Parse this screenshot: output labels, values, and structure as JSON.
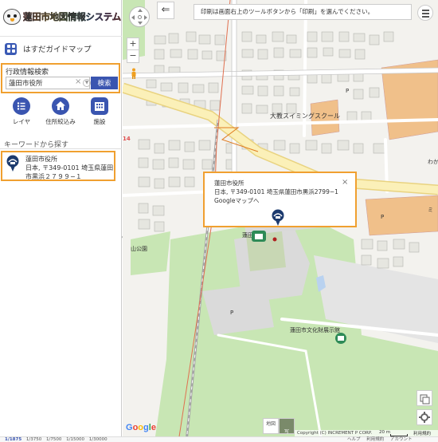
{
  "app": {
    "title": "蓮田市地図情報システム",
    "guide_map": "はすだガイドマップ"
  },
  "search": {
    "label": "行政情報検索",
    "value": "蓮田市役所",
    "clear_glyph": "×",
    "button": "検索"
  },
  "tools": [
    {
      "label": "レイヤ",
      "icon": "list-icon"
    },
    {
      "label": "住所絞込み",
      "icon": "home-icon"
    },
    {
      "label": "施設",
      "icon": "building-icon"
    }
  ],
  "keyword_label": "キーワードから探す",
  "result": {
    "name": "蓮田市役所",
    "address": "日本, 〒349-0101 埼玉県蓮田市黒浜２７９９−１"
  },
  "collapse_glyph": "«",
  "map": {
    "notice": "印刷は画面右上のツールボタンから「印刷」を選んでください。",
    "back_glyph": "⇐",
    "zoom_in": "+",
    "zoom_out": "−",
    "labels": {
      "swimming": "大教スイミングスクール",
      "city_hall": "蓮田市役",
      "park": "山公園",
      "museum": "蓮田市文化財展示館",
      "p1": "P",
      "p2": "P",
      "p3": "P",
      "road_num": "14",
      "right_edge": "わか",
      "right_mi": "ミ"
    },
    "popup": {
      "name": "蓮田市役所",
      "address": "日本, 〒349-0101 埼玉県蓮田市黒浜2799−1",
      "link": "Googleマップへ",
      "close": "×"
    },
    "google": [
      "G",
      "o",
      "o",
      "g",
      "l",
      "e"
    ],
    "map_type_map": "地図",
    "map_type_photo": "写",
    "copyright": "Copyright (C) INCREMENT P CORP.",
    "scale": "20 m",
    "scale_right": "利用規約"
  },
  "bottom": {
    "scales": [
      "1/1875",
      "1/3750",
      "1/7500",
      "1/15000",
      "1/30000"
    ],
    "links": [
      "ヘルプ",
      "利用規約",
      "アカウント"
    ]
  },
  "colors": {
    "accent": "#3a55b0",
    "highlight_border": "#f0a030",
    "building_orange": "#f0c08a",
    "green_area": "#c8e6b4"
  }
}
